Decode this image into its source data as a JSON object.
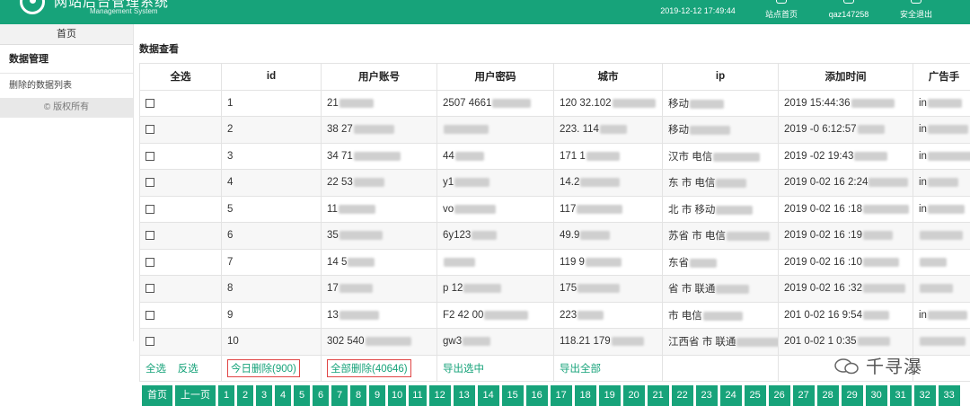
{
  "header": {
    "title": "网站后台管理系统",
    "subtitle": "Management System",
    "datetime": "2019-12-12 17:49:44",
    "home_link": "站点首页",
    "username": "qaz147258",
    "logout": "安全退出",
    "bg_color": "#17a37a"
  },
  "sidebar": {
    "home": "首页",
    "section": "数据管理",
    "items": [
      "删除的数据列表"
    ],
    "copyright": "© 版权所有"
  },
  "main": {
    "title": "数据查看",
    "columns": [
      "全选",
      "id",
      "用户账号",
      "用户密码",
      "城市",
      "ip",
      "添加时间",
      "广告手"
    ],
    "rows": [
      {
        "id": "1",
        "account": "21",
        "password": "2507  4661",
        "city": "120  32.102",
        "ip": "移动",
        "time": "2019  15:44:36",
        "ad": "in"
      },
      {
        "id": "2",
        "account": "38  27",
        "password": "",
        "city": "223.  114",
        "ip": "移动",
        "time": "2019  -0  6:12:57",
        "ad": "in"
      },
      {
        "id": "3",
        "account": "34  71",
        "password": "44",
        "city": "171  1",
        "ip": "汉市 电信",
        "time": "2019  -02  19:43",
        "ad": "in"
      },
      {
        "id": "4",
        "account": "22  53",
        "password": "y1",
        "city": "14.2",
        "ip": "东  市 电信",
        "time": "2019  0-02 16  2:24",
        "ad": "in"
      },
      {
        "id": "5",
        "account": "11",
        "password": "vo",
        "city": "117",
        "ip": "北  市 移动",
        "time": "2019  0-02 16  :18",
        "ad": "in"
      },
      {
        "id": "6",
        "account": "35",
        "password": "6y123",
        "city": "49.9",
        "ip": "苏省  市 电信",
        "time": "2019  0-02 16  :19",
        "ad": ""
      },
      {
        "id": "7",
        "account": "14  5",
        "password": "",
        "city": "119  9",
        "ip": "东省",
        "time": "2019  0-02 16  :10",
        "ad": ""
      },
      {
        "id": "8",
        "account": "17",
        "password": "p  12",
        "city": "175",
        "ip": "省  市 联通",
        "time": "2019  0-02 16  :32",
        "ad": ""
      },
      {
        "id": "9",
        "account": "13",
        "password": "F2  42  00",
        "city": "223",
        "ip": "  市 电信",
        "time": "201  0-02 16  9:54",
        "ad": "in"
      },
      {
        "id": "10",
        "account": "302  540",
        "password": "gw3",
        "city": "118.21  179",
        "ip": "江西省  市 联通",
        "time": "201  0-02 1  0:35",
        "ad": ""
      }
    ],
    "actions": {
      "select_all": "全选",
      "invert": "反选",
      "delete_today": "今日删除(900)",
      "delete_all": "全部删除(40646)",
      "export_selected": "导出选中",
      "export_all": "导出全部"
    }
  },
  "pagination": {
    "first": "首页",
    "prev": "上一页",
    "pages": [
      "1",
      "2",
      "3",
      "4",
      "5",
      "6",
      "7",
      "8",
      "9",
      "10",
      "11",
      "12",
      "13",
      "14",
      "15",
      "16",
      "17",
      "18",
      "19",
      "20",
      "21",
      "22",
      "23",
      "24",
      "25",
      "26",
      "27",
      "28",
      "29",
      "30",
      "31",
      "32",
      "33"
    ]
  },
  "watermark": {
    "text": "千寻瀑"
  }
}
